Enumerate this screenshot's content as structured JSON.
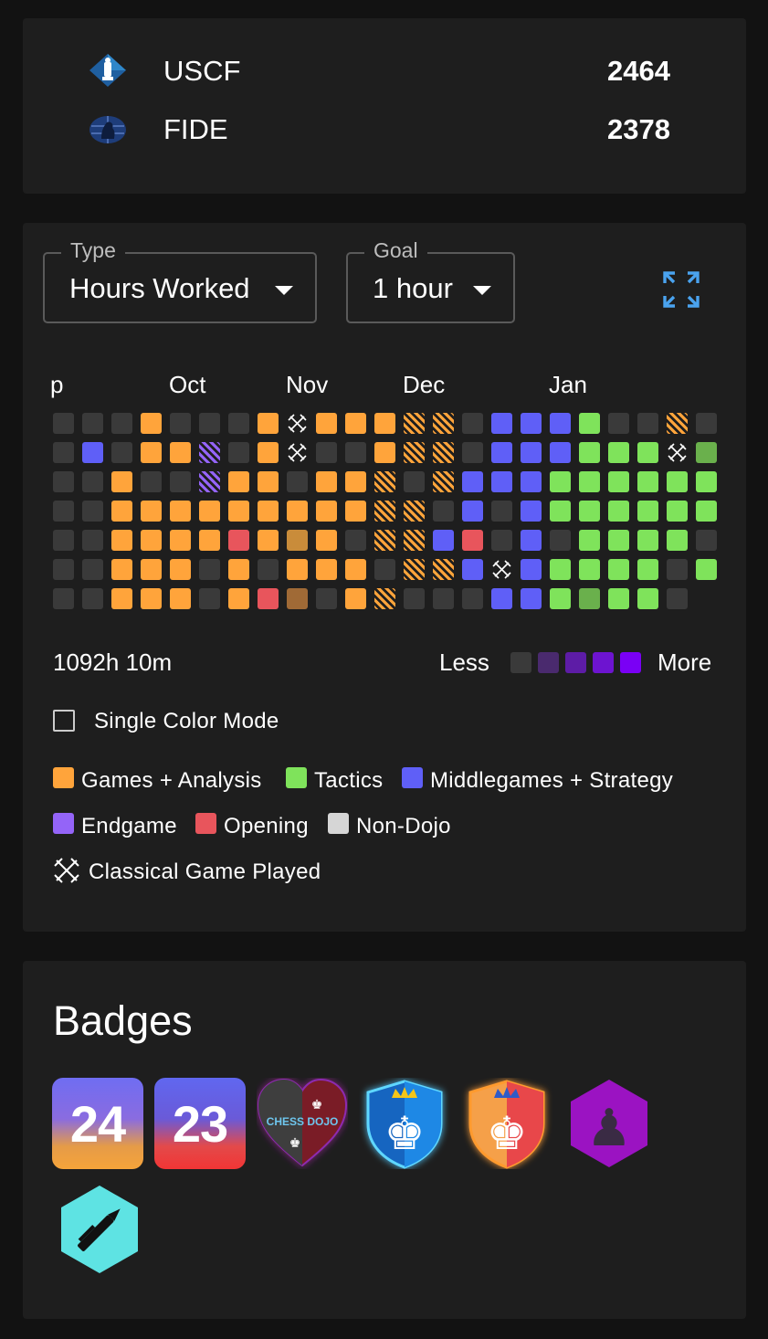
{
  "ratings": [
    {
      "name": "USCF",
      "value": "2464",
      "icon": "uscf-logo-icon"
    },
    {
      "name": "FIDE",
      "value": "2378",
      "icon": "fide-logo-icon"
    }
  ],
  "activity": {
    "type_select": {
      "label": "Type",
      "value": "Hours Worked"
    },
    "goal_select": {
      "label": "Goal",
      "value": "1 hour"
    },
    "months": [
      "p",
      "Oct",
      "Nov",
      "Dec",
      "Jan"
    ],
    "total": "1092h 10m",
    "less_label": "Less",
    "more_label": "More",
    "scale_colors": [
      "#3a3a3a",
      "#4a2a6e",
      "#5d1ca6",
      "#6d14d0",
      "#7a00f5"
    ],
    "single_color_mode": {
      "label": "Single Color Mode",
      "checked": false
    },
    "legend": [
      {
        "label": "Games + Analysis",
        "color": "#ffa43b"
      },
      {
        "label": "Tactics",
        "color": "#7fe35b"
      },
      {
        "label": "Middlegames + Strategy",
        "color": "#5f5ff7"
      },
      {
        "label": "Endgame",
        "color": "#9464f8"
      },
      {
        "label": "Opening",
        "color": "#e8555c"
      },
      {
        "label": "Non-Dojo",
        "color": "#d6d6d6"
      }
    ],
    "classical_game_label": "Classical Game Played",
    "heatmap_grid": [
      "EEEOEEEOXOOOHHEMMMTEEHE",
      "EMEOOPEOXEEOHHEMMMTTTXt",
      "EEOEEPOOEOOHEHMMMTTTTTT",
      "EEOOOOOOOOOHHEMEMTTTTTT",
      "EEOOOORObOEHHMREMETTTTE",
      "EEOOOEOEOOOEHHMXMTTTTET",
      "EEOOOEORoEOHEEEMMTtTTE."
    ],
    "heatmap_key": {
      "E": "empty",
      "O": "games-analysis",
      "T": "tactics",
      "t": "tactics-dim",
      "M": "middlegames-strategy",
      "m": "middlegames-dim",
      "P": "endgame-hatched",
      "H": "games-analysis-hatched",
      "R": "opening",
      "b": "games-analysis-dim",
      "o": "games-analysis-dark",
      "X": "classical-game",
      "x": "classical-game",
      ".": "none"
    }
  },
  "badges": {
    "title": "Badges",
    "items": [
      {
        "name": "year-2024-badge",
        "text": "24"
      },
      {
        "name": "year-2023-badge",
        "text": "23"
      },
      {
        "name": "chess-dojo-heart-badge",
        "text": "CHESS DOJO"
      },
      {
        "name": "blue-king-shield-badge"
      },
      {
        "name": "orange-king-shield-badge"
      },
      {
        "name": "purple-pawn-hexagon-badge"
      },
      {
        "name": "cyan-pen-hexagon-badge"
      }
    ]
  }
}
